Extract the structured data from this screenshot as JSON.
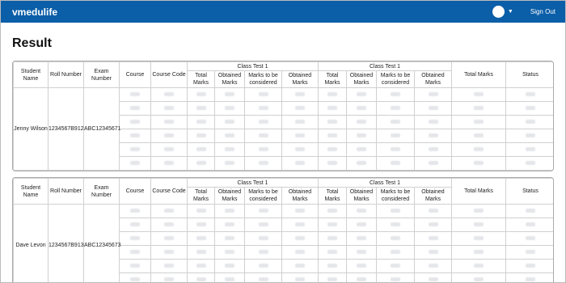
{
  "app": {
    "brand": "vmedulife",
    "sign_out": "Sign Out"
  },
  "page": {
    "title": "Result"
  },
  "table": {
    "headers": {
      "student_name": "Student Name",
      "roll_number": "Roll Number",
      "exam_number": "Exam Number",
      "course": "Course",
      "course_code": "Course Code",
      "class_test_1": "Class Test 1",
      "class_test_2": "Class Test 1",
      "total_marks": "Total Marks",
      "obtained_marks": "Obtained Marks",
      "marks_considered": "Marks to be considered",
      "obtained_marks_2": "Obtained Marks",
      "overall_total": "Total Marks",
      "status": "Status"
    }
  },
  "students": [
    {
      "name": "Jenny Wilson",
      "roll": "1234567B912",
      "exam": "ABC12345671",
      "rows": 6
    },
    {
      "name": "Dave Levon",
      "roll": "1234567B913",
      "exam": "ABC12345673",
      "rows": 6
    }
  ]
}
